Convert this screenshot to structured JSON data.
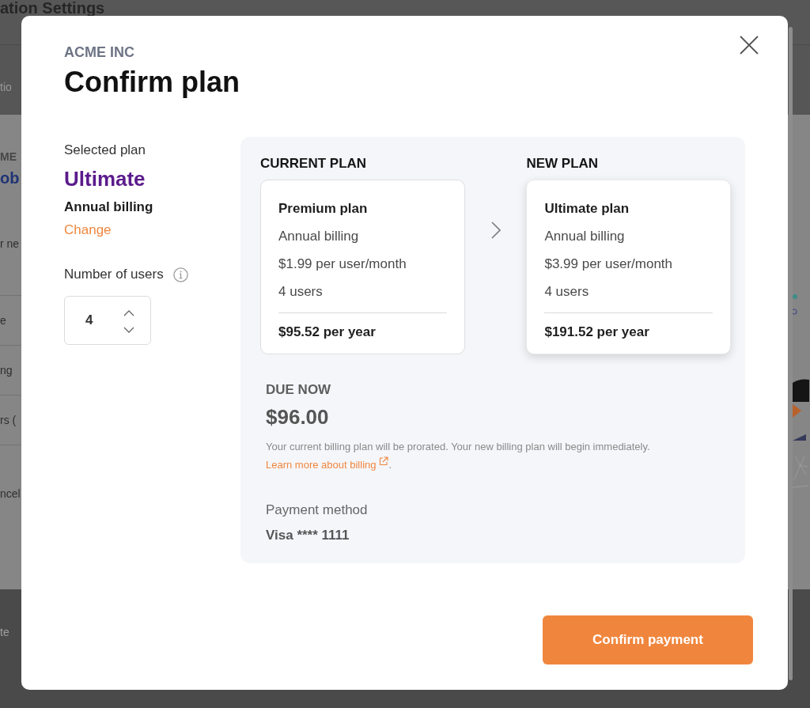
{
  "background_page": {
    "heading": "ation Settings",
    "subheading": "tio",
    "fragments": [
      {
        "kind": "eyebrow",
        "text": "ME"
      },
      {
        "kind": "heading",
        "text": "ob"
      },
      {
        "kind": "text",
        "text": "r ne"
      },
      {
        "kind": "row",
        "text": "e"
      },
      {
        "kind": "row",
        "text": "ng"
      },
      {
        "kind": "row",
        "text": "rs ("
      },
      {
        "kind": "text",
        "text": "ncel"
      }
    ],
    "footer_text": "te"
  },
  "dialog": {
    "company": "ACME INC",
    "title": "Confirm plan"
  },
  "selection": {
    "label": "Selected plan",
    "plan": "Ultimate",
    "billing": "Annual billing",
    "change_link": "Change",
    "users_label": "Number of users",
    "users_value": "4"
  },
  "plans": [
    {
      "heading": "CURRENT PLAN",
      "name": "Premium plan",
      "billing": "Annual billing",
      "price": "$1.99 per user/month",
      "users": "4 users",
      "total": "$95.52 per year",
      "highlighted": false
    },
    {
      "heading": "NEW PLAN",
      "name": "Ultimate plan",
      "billing": "Annual billing",
      "price": "$3.99 per user/month",
      "users": "4 users",
      "total": "$191.52 per year",
      "highlighted": true
    }
  ],
  "due": {
    "label": "DUE NOW",
    "amount": "$96.00",
    "note": "Your current billing plan will be prorated. Your new billing plan will begin immediately.",
    "link": "Learn more about billing",
    "after_link": "."
  },
  "payment": {
    "label": "Payment method",
    "card": "Visa **** 1111"
  },
  "confirm_button": "Confirm payment"
}
